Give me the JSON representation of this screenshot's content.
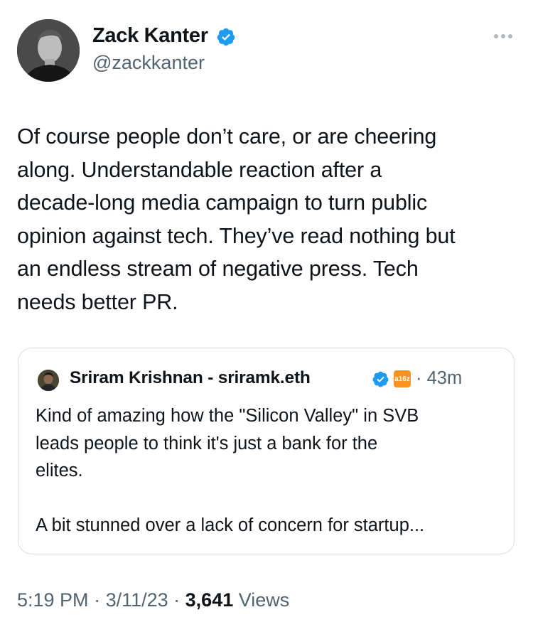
{
  "author": {
    "name": "Zack Kanter",
    "handle": "@zackkanter",
    "verified": true
  },
  "tweet": {
    "text_lines": [
      "Of course people don’t care, or are cheering",
      "along. Understandable reaction after a",
      "decade-long media campaign to turn public",
      "opinion against tech. They’ve read nothing but",
      "an endless stream of negative press. Tech",
      "needs better PR."
    ]
  },
  "quote": {
    "name": "Sriram Krishnan - sriramk.eth",
    "verified": true,
    "affiliate_badge": "a16z",
    "time": "· 43m",
    "text_lines": [
      "Kind of amazing how the \"Silicon Valley\" in SVB",
      "leads people to think it's just a bank for the",
      "elites.",
      "",
      "A bit stunned over a lack of concern for startup..."
    ]
  },
  "meta": {
    "time": "5:19 PM",
    "sep1": " · ",
    "date": "3/11/23",
    "sep2": " · ",
    "views_count": "3,641",
    "views_label": " Views"
  },
  "colors": {
    "verified_blue": "#1d9bf0",
    "secondary_text": "#536471",
    "primary_text": "#0f1419",
    "badge_orange": "#f7931e"
  },
  "icons": {
    "verified": "verified-badge-icon",
    "more": "more-horizontal-icon"
  }
}
